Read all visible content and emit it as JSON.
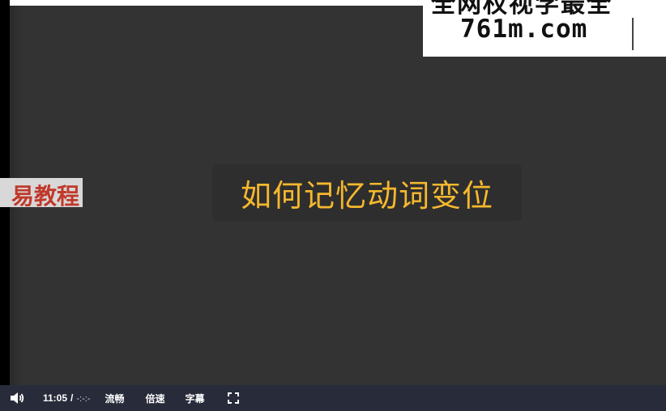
{
  "video": {
    "title_overlay": "如何记忆动词变位",
    "side_label": "易教程",
    "watermark_top": "全网权视学最全",
    "watermark_domain": "761m.com"
  },
  "controls": {
    "current_time": "11:05",
    "separator": "/",
    "duration": "-:-:-",
    "quality_label": "流畅",
    "speed_label": "倍速",
    "subtitle_label": "字幕",
    "volume_icon": "speaker-icon",
    "fullscreen_icon": "fullscreen-icon"
  },
  "colors": {
    "video_background": "#333333",
    "title_color": "#f5b82e",
    "control_bar": "#282c3a",
    "side_label_color": "#c0392b"
  }
}
